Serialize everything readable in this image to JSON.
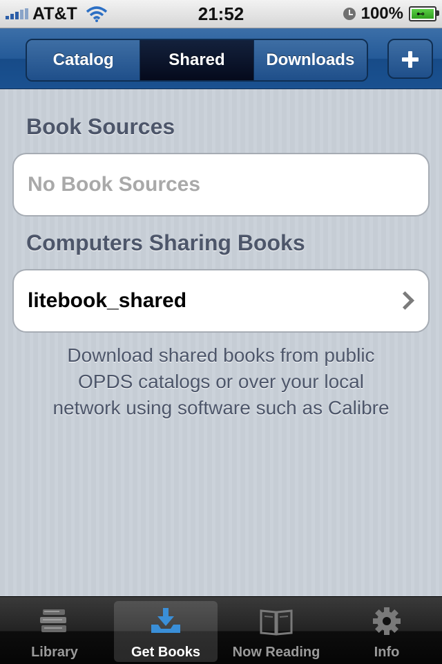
{
  "status_bar": {
    "carrier": "AT&T",
    "time": "21:52",
    "battery": "100%"
  },
  "nav": {
    "segments": [
      "Catalog",
      "Shared",
      "Downloads"
    ],
    "selected_segment": "Shared"
  },
  "sections": {
    "book_sources": {
      "header": "Book Sources",
      "empty_text": "No Book Sources"
    },
    "computers": {
      "header": "Computers Sharing Books",
      "items": [
        "litebook_shared"
      ]
    }
  },
  "footer_lines": [
    "Download shared books from public",
    "OPDS catalogs or over your local",
    "network using software such as Calibre"
  ],
  "tabs": [
    {
      "label": "Library",
      "icon": "books-stack-icon"
    },
    {
      "label": "Get Books",
      "icon": "download-tray-icon"
    },
    {
      "label": "Now Reading",
      "icon": "open-book-icon"
    },
    {
      "label": "Info",
      "icon": "gear-icon"
    }
  ],
  "selected_tab": "Get Books",
  "colors": {
    "nav_blue": "#245a98",
    "section_text": "#4d566a",
    "selected_tab_icon": "#3a8fd8"
  }
}
